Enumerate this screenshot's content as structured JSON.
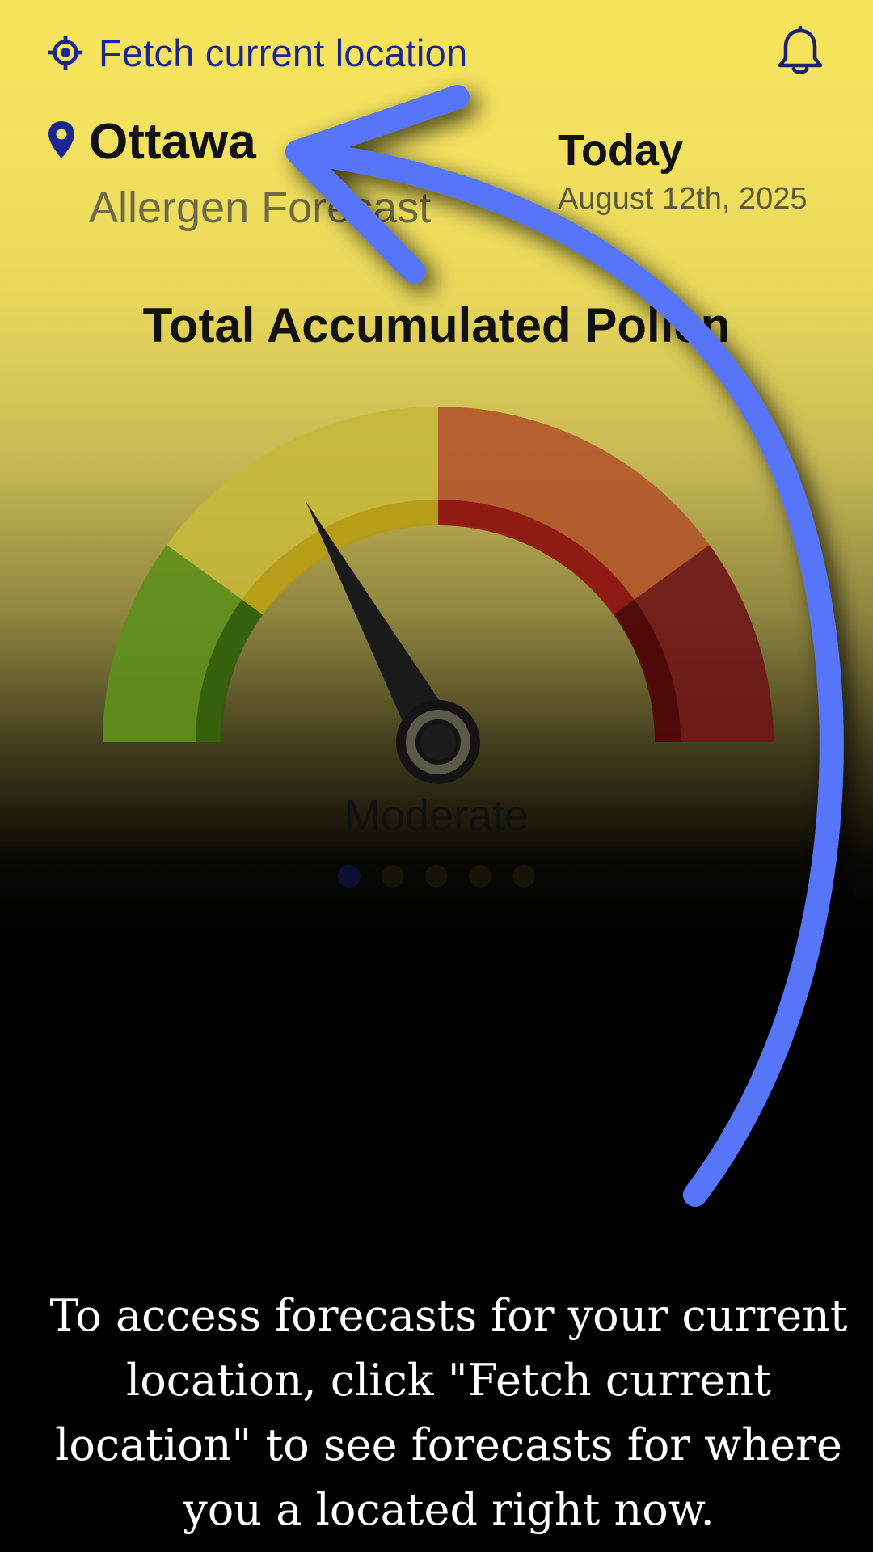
{
  "header": {
    "fetch_label": "Fetch current location",
    "fetch_icon": "crosshair-location-icon",
    "notification_icon": "bell-icon"
  },
  "location": {
    "city": "Ottawa",
    "subtitle": "Allergen Forecast",
    "pin_icon": "map-pin-icon"
  },
  "date_block": {
    "title": "Today",
    "date": "August 12th, 2025"
  },
  "gauge": {
    "title": "Total Accumulated Pollen",
    "level_label": "Moderate",
    "level_fraction": 0.34,
    "segments": [
      "green",
      "yellow",
      "orange",
      "red"
    ],
    "colors": {
      "green": "#5f8f1c",
      "yellow": "#c7b83b",
      "orange": "#b3552a",
      "red": "#6e1616",
      "needle": "#1a1a1a"
    }
  },
  "pager": {
    "count": 5,
    "active_index": 0
  },
  "tutorial": {
    "text": "To access forecasts for your current location, click \"Fetch current location\" to see forecasts for where you a located right now.",
    "arrow_color": "#5774f8"
  }
}
